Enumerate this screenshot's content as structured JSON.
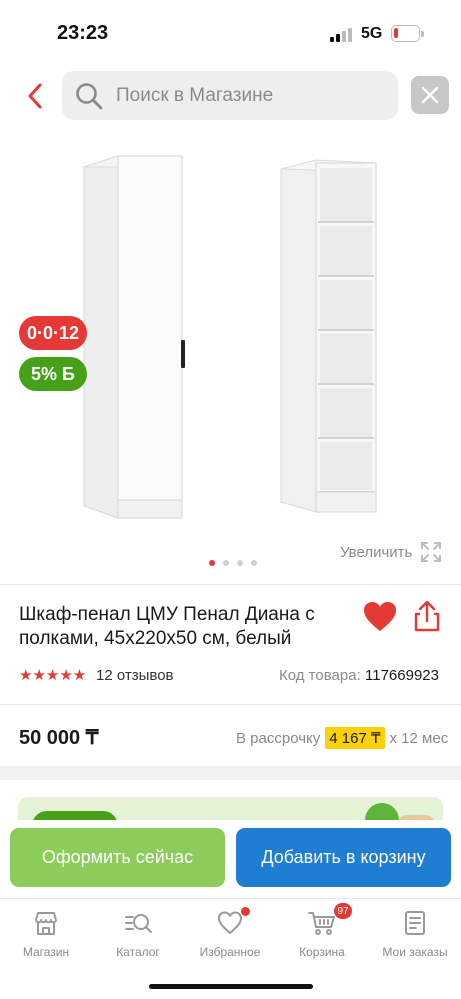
{
  "status_bar": {
    "time": "23:23",
    "network": "5G"
  },
  "search": {
    "placeholder": "Поиск в Магазине",
    "value": ""
  },
  "product": {
    "badges": {
      "installment": "0·0·12",
      "bonus": "5% Б"
    },
    "image_dots": {
      "count": 4,
      "active": 0
    },
    "zoom_label": "Увеличить",
    "title": "Шкаф-пенал ЦМУ Пенал Диана с полками, 45х220х50 см, белый",
    "rating": {
      "stars": 5,
      "reviews": "12 отзывов"
    },
    "sku_label": "Код товара:",
    "sku": "117669923",
    "price": "50 000 ₸",
    "credit": {
      "prefix": "В рассрочку",
      "amount": "4 167 ₸",
      "suffix": "x 12 мес"
    }
  },
  "actions": {
    "buy_now": "Оформить сейчас",
    "add_to_cart": "Добавить в корзину"
  },
  "tabbar": {
    "items": [
      {
        "label": "Магазин",
        "icon": "shop-icon"
      },
      {
        "label": "Каталог",
        "icon": "catalog-search-icon"
      },
      {
        "label": "Избранное",
        "icon": "heart-icon"
      },
      {
        "label": "Корзина",
        "icon": "cart-icon",
        "badge": "97"
      },
      {
        "label": "Мои заказы",
        "icon": "orders-icon"
      }
    ]
  },
  "colors": {
    "accent_red": "#e53935",
    "bonus_green": "#47a01a",
    "buy_green": "#8bcc5a",
    "cart_blue": "#1f7ed1",
    "credit_yellow": "#fcd10a"
  }
}
